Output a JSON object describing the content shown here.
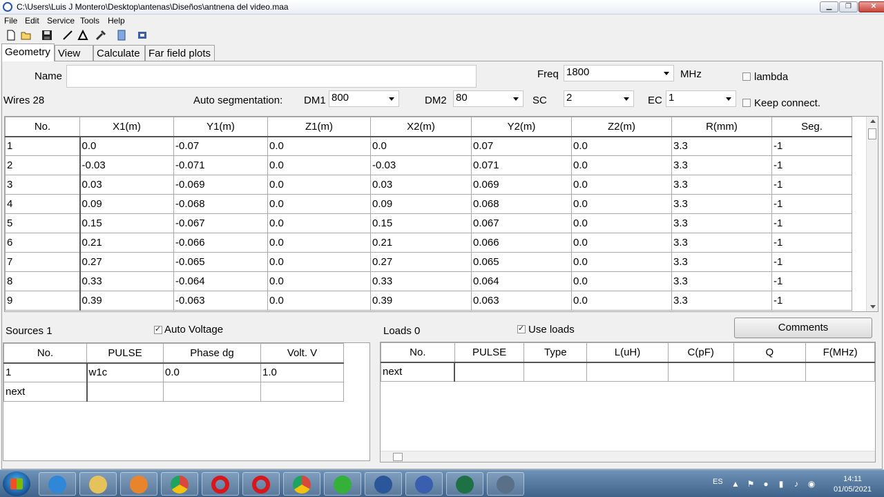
{
  "window": {
    "title": "C:\\Users\\Luis J Montero\\Desktop\\antenas\\Diseños\\antnena del video.maa"
  },
  "menu": [
    "File",
    "Edit",
    "Service",
    "Tools",
    "Help"
  ],
  "tabs": [
    "Geometry",
    "View",
    "Calculate",
    "Far field plots"
  ],
  "geometry": {
    "name_label": "Name",
    "name_value": "",
    "freq_label": "Freq",
    "freq_value": "1800",
    "freq_unit": "MHz",
    "lambda_label": "lambda",
    "lambda_checked": false,
    "wires_label": "Wires 28",
    "autoseg_label": "Auto segmentation:",
    "dm1_label": "DM1",
    "dm1_value": "800",
    "dm2_label": "DM2",
    "dm2_value": "80",
    "sc_label": "SC",
    "sc_value": "2",
    "ec_label": "EC",
    "ec_value": "1",
    "keep_label": "Keep connect.",
    "keep_checked": false
  },
  "wires": {
    "columns": [
      "No.",
      "X1(m)",
      "Y1(m)",
      "Z1(m)",
      "X2(m)",
      "Y2(m)",
      "Z2(m)",
      "R(mm)",
      "Seg."
    ],
    "rows": [
      [
        "1",
        "0.0",
        "-0.07",
        "0.0",
        "0.0",
        "0.07",
        "0.0",
        "3.3",
        "-1"
      ],
      [
        "2",
        "-0.03",
        "-0.071",
        "0.0",
        "-0.03",
        "0.071",
        "0.0",
        "3.3",
        "-1"
      ],
      [
        "3",
        "0.03",
        "-0.069",
        "0.0",
        "0.03",
        "0.069",
        "0.0",
        "3.3",
        "-1"
      ],
      [
        "4",
        "0.09",
        "-0.068",
        "0.0",
        "0.09",
        "0.068",
        "0.0",
        "3.3",
        "-1"
      ],
      [
        "5",
        "0.15",
        "-0.067",
        "0.0",
        "0.15",
        "0.067",
        "0.0",
        "3.3",
        "-1"
      ],
      [
        "6",
        "0.21",
        "-0.066",
        "0.0",
        "0.21",
        "0.066",
        "0.0",
        "3.3",
        "-1"
      ],
      [
        "7",
        "0.27",
        "-0.065",
        "0.0",
        "0.27",
        "0.065",
        "0.0",
        "3.3",
        "-1"
      ],
      [
        "8",
        "0.33",
        "-0.064",
        "0.0",
        "0.33",
        "0.064",
        "0.0",
        "3.3",
        "-1"
      ],
      [
        "9",
        "0.39",
        "-0.063",
        "0.0",
        "0.39",
        "0.063",
        "0.0",
        "3.3",
        "-1"
      ]
    ]
  },
  "sources": {
    "label": "Sources 1",
    "auto_voltage_label": "Auto Voltage",
    "auto_voltage_checked": true,
    "columns": [
      "No.",
      "PULSE",
      "Phase dg",
      "Volt. V"
    ],
    "rows": [
      [
        "1",
        "w1c",
        "0.0",
        "1.0"
      ],
      [
        "next",
        "",
        "",
        ""
      ]
    ]
  },
  "loads": {
    "label": "Loads 0",
    "use_loads_label": "Use loads",
    "use_loads_checked": true,
    "comments_label": "Comments",
    "columns": [
      "No.",
      "PULSE",
      "Type",
      "L(uH)",
      "C(pF)",
      "Q",
      "F(MHz)"
    ],
    "rows": [
      [
        "next",
        "",
        "",
        "",
        "",
        "",
        ""
      ]
    ]
  },
  "taskbar": {
    "apps": [
      "internet-explorer-icon",
      "file-explorer-icon",
      "media-player-icon",
      "chrome-icon",
      "opera-icon",
      "opera-icon",
      "chrome-icon",
      "network-app-icon",
      "word-icon",
      "mmana-icon",
      "excel-icon",
      "antenna-icon"
    ],
    "lang": "ES",
    "time": "14:11",
    "date": "01/05/2021"
  }
}
